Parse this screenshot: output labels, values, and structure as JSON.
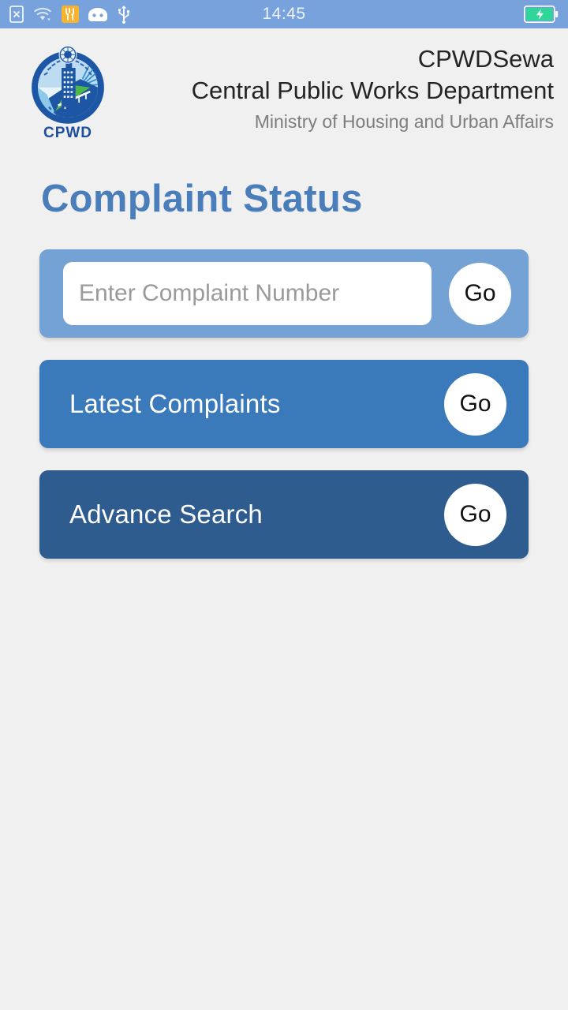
{
  "statusbar": {
    "time": "14:45",
    "icons_left": [
      "sim-card-error-icon",
      "wifi-icon",
      "developer-tools-icon",
      "cyanogenmod-icon",
      "usb-icon"
    ],
    "battery": "battery-charging-icon",
    "background_color": "#77a2dc",
    "battery_color": "#2fd69a"
  },
  "header": {
    "logo_label": "CPWD",
    "app_name": "CPWDSewa",
    "department": "Central Public Works Department",
    "ministry": "Ministry of Housing and Urban Affairs"
  },
  "page": {
    "title": "Complaint Status",
    "title_color": "#4a7ebb",
    "background_color": "#f0f0f0"
  },
  "cards": [
    {
      "name": "complaint-number-search",
      "type": "input",
      "placeholder": "Enter Complaint Number",
      "value": "",
      "go_label": "Go",
      "color": "#74a2d4"
    },
    {
      "name": "latest-complaints",
      "type": "link",
      "label": "Latest Complaints",
      "go_label": "Go",
      "color": "#3a79ba"
    },
    {
      "name": "advance-search",
      "type": "link",
      "label": "Advance Search",
      "go_label": "Go",
      "color": "#2e5c8f"
    }
  ]
}
